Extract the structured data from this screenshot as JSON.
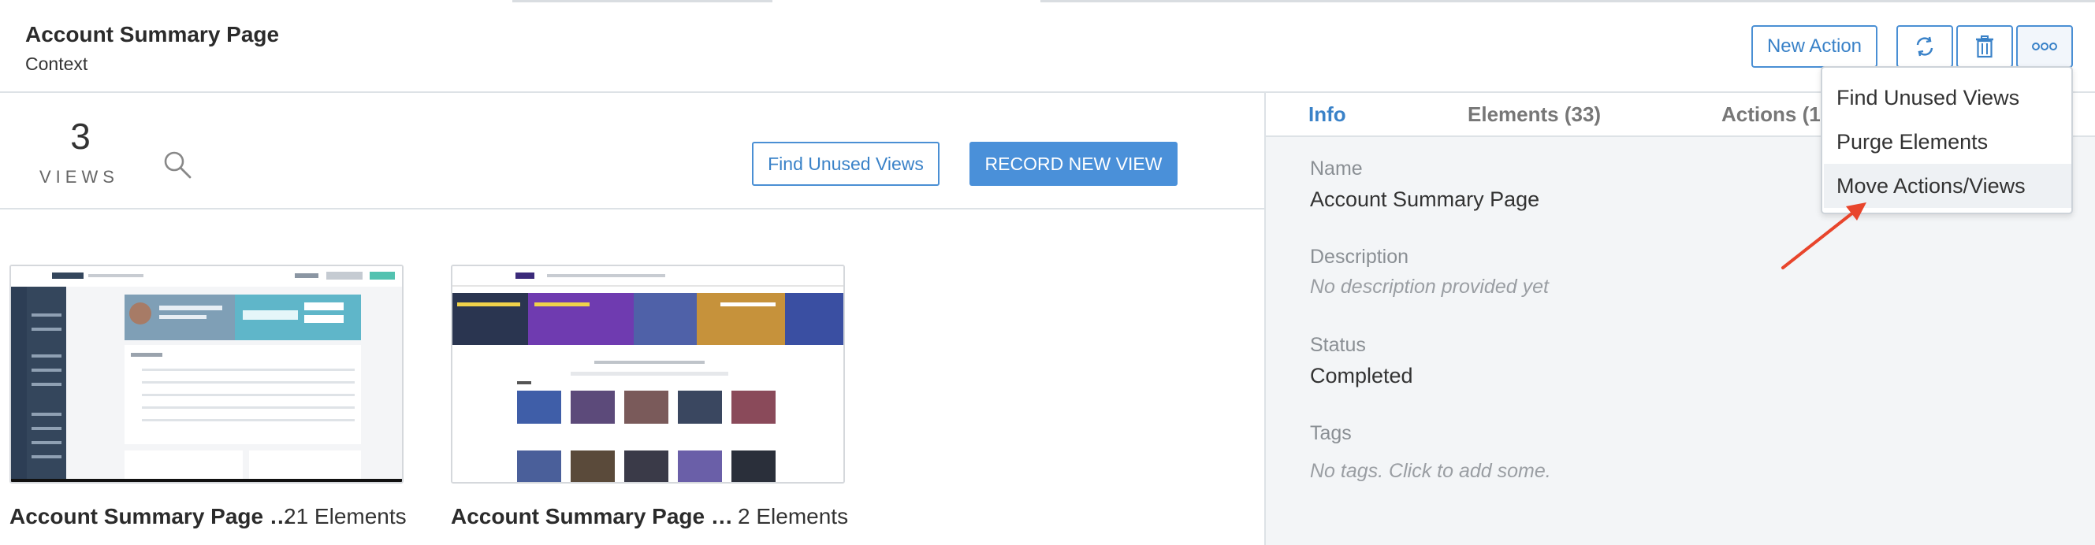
{
  "header": {
    "title": "Account Summary Page",
    "subtitle": "Context",
    "buttons": {
      "new_action": "New Action"
    },
    "icons": [
      "refresh-icon",
      "trash-icon",
      "more-icon"
    ]
  },
  "views": {
    "count": "3",
    "label": "VIEWS",
    "find_unused_label": "Find Unused Views",
    "record_label": "RECORD NEW VIEW",
    "cards": [
      {
        "name": "Account Summary Page …",
        "count": "21 Elements"
      },
      {
        "name": "Account Summary Page …",
        "count": "2 Elements"
      }
    ]
  },
  "details": {
    "tabs": [
      "Info",
      "Elements (33)",
      "Actions (1"
    ],
    "active_tab": "Info",
    "fields": {
      "name_label": "Name",
      "name_value": "Account Summary Page",
      "description_label": "Description",
      "description_value": "No description provided yet",
      "status_label": "Status",
      "status_value": "Completed",
      "tags_label": "Tags",
      "tags_value": "No tags. Click to add some."
    }
  },
  "dropdown": {
    "items": [
      "Find Unused Views",
      "Purge Elements",
      "Move Actions/Views"
    ],
    "highlighted": "Move Actions/Views"
  },
  "colors": {
    "accent": "#4a90d9",
    "annotation_arrow": "#e8452c",
    "panel_bg": "#f3f5f7"
  }
}
